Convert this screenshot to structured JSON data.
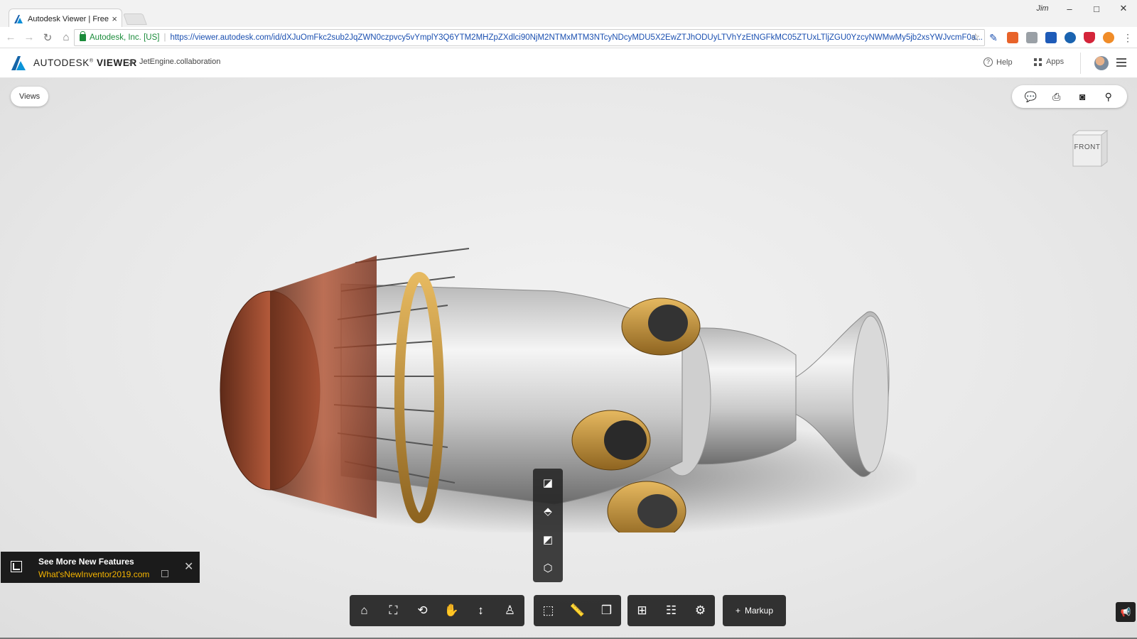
{
  "browser": {
    "tab_title": "Autodesk Viewer | Free O",
    "tab_close": "×",
    "window_user": "Jim",
    "minimize": "–",
    "maximize": "□",
    "close": "✕",
    "secure_label": "Autodesk, Inc. [US]",
    "url_separator": "|",
    "url": "https://viewer.autodesk.com/id/dXJuOmFkc2sub2JqZWN0czpvcy5vYmplY3Q6YTM2MHZpZXdlci90NjM2NTMxMTM3NTcyNDcyMDU5X2EwZTJhODUyLTVhYzEtNGFkMC05ZTUxLTljZGU0YzcyNWMwMy5jb2xsYWJvcmF0a..."
  },
  "header": {
    "brand_prefix": "AUTODESK",
    "brand_reg": "®",
    "brand_suffix": " VIEWER",
    "breadcrumb_separator": ">",
    "file_name": "JetEngine.collaboration",
    "help_label": "Help",
    "help_glyph": "?",
    "apps_label": "Apps"
  },
  "viewer": {
    "views_label": "Views",
    "viewcube_face": "FRONT"
  },
  "toolbar": {
    "markup_plus": "+",
    "markup_label": "Markup"
  },
  "notification": {
    "title": "See More New Features",
    "link": "What'sNewInventor2019.com",
    "close": "✕"
  },
  "colors": {
    "accent_link": "#f5b400",
    "toolbar_bg": "#222222",
    "secure_green": "#1a8b3a",
    "url_blue": "#1a4fb0"
  },
  "icons": {
    "top_tools": [
      "comment-icon",
      "print-icon",
      "camera-icon",
      "share-link-icon"
    ],
    "flyout": [
      "orthographic-icon",
      "perspective-icon",
      "perspective-ortho-faces-icon",
      "cube-icon"
    ],
    "nav_group": [
      "home-icon",
      "fit-icon",
      "orbit-icon",
      "pan-icon",
      "zoom-icon",
      "first-person-icon"
    ],
    "tools_group": [
      "section-cube-icon",
      "measure-icon",
      "explode-icon"
    ],
    "settings_group": [
      "model-browser-icon",
      "properties-icon",
      "settings-icon"
    ]
  }
}
